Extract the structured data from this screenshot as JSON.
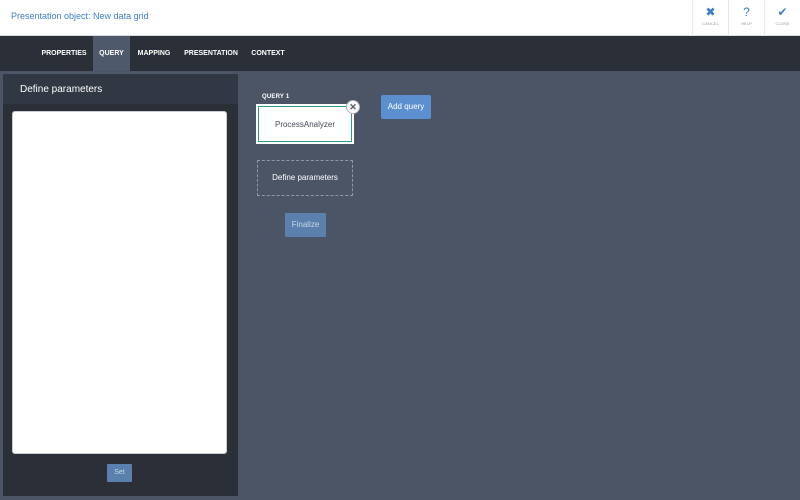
{
  "window": {
    "title": "Presentation object: New data grid"
  },
  "header_actions": [
    {
      "label": "CANCEL",
      "icon": "close-icon",
      "glyph": "✖"
    },
    {
      "label": "HELP",
      "icon": "help-icon",
      "glyph": "?"
    },
    {
      "label": "CLOSE",
      "icon": "checkmark-icon",
      "glyph": "✔"
    }
  ],
  "tabs": [
    {
      "label": "PROPERTIES",
      "active": false
    },
    {
      "label": "QUERY",
      "active": true
    },
    {
      "label": "MAPPING",
      "active": false
    },
    {
      "label": "PRESENTATION",
      "active": false
    },
    {
      "label": "CONTEXT",
      "active": false
    }
  ],
  "left_panel": {
    "title": "Define parameters",
    "textarea_value": "",
    "set_label": "Set"
  },
  "query": {
    "label": "QUERY 1",
    "name": "ProcessAnalyzer",
    "remove_glyph": "✕",
    "add_label": "Add query",
    "define_parameters_label": "Define parameters",
    "finalize_label": "Finalize"
  },
  "colors": {
    "accent": "#3d7fc7",
    "tab_bar": "#2a2f38",
    "active_tab": "#4e5a6b",
    "canvas": "#4b5566",
    "button": "#5b8fd0"
  }
}
